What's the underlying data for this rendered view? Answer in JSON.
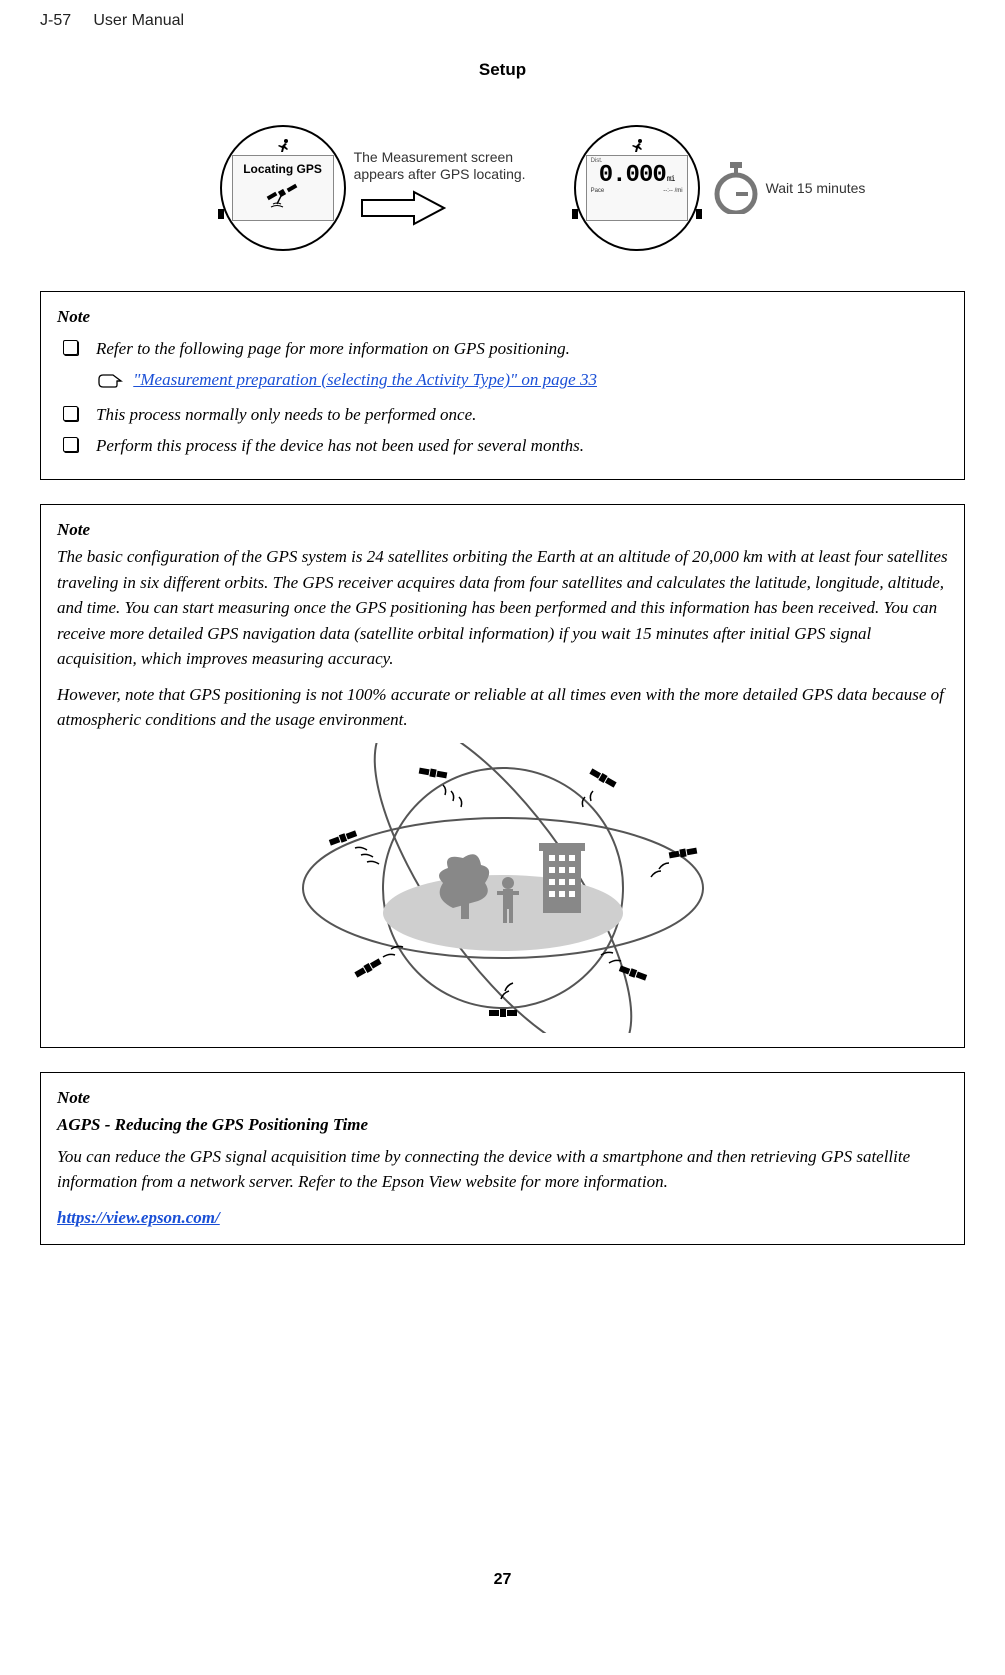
{
  "header": {
    "product": "J-57",
    "doc": "User Manual"
  },
  "section_title": "Setup",
  "figure": {
    "caption": "The Measurement screen appears after GPS locating.",
    "wait_label": "Wait 15 minutes",
    "watch_left": {
      "status": "Locating GPS"
    },
    "watch_right": {
      "dist_label": "Dist.",
      "value": "0.000",
      "unit": "mi",
      "pace_label": "Pace",
      "pace_val": "--:--",
      "pace_unit": "/mi"
    }
  },
  "note1": {
    "title": "Note",
    "items": [
      "Refer to the following page for more information on GPS positioning.",
      "This process normally only needs to be performed once.",
      "Perform this process if the device has not been used for several months."
    ],
    "link_text": "\"Measurement preparation (selecting the Activity Type)\" on page 33"
  },
  "note2": {
    "title": "Note",
    "p1": "The basic configuration of the GPS system is 24 satellites orbiting the Earth at an altitude of 20,000 km with at least four satellites traveling in six different orbits. The GPS receiver acquires data from four satellites and calculates the latitude, longitude, altitude, and time. You can start measuring once the GPS positioning has been performed and this information has been received. You can receive more detailed GPS navigation data (satellite orbital information) if you wait 15 minutes after initial GPS signal acquisition, which improves measuring accuracy.",
    "p2": "However, note that GPS positioning is not 100% accurate or reliable at all times even with the more detailed GPS data because of atmospheric conditions and the usage environment."
  },
  "note3": {
    "title": "Note",
    "subheading": "AGPS - Reducing the GPS Positioning Time",
    "body": "You can reduce the GPS signal acquisition time by connecting the device with a smartphone and then retrieving GPS satellite information from a network server. Refer to the Epson View website for more information.",
    "url": "https://view.epson.com/"
  },
  "page_number": "27"
}
